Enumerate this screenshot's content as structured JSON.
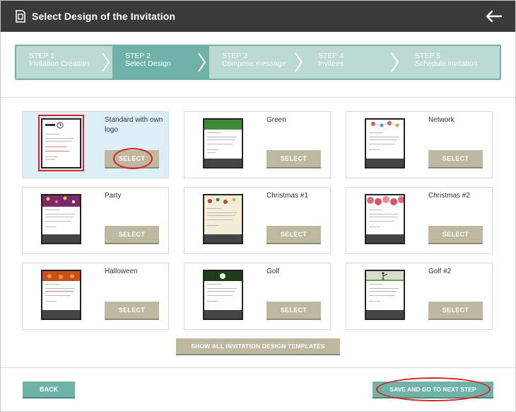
{
  "header": {
    "title": "Select Design of the Invitation",
    "icon": "invitation-doc-icon",
    "back_icon": "arrow-left-icon"
  },
  "stepper": {
    "steps": [
      {
        "num": "STEP 1",
        "label": "Invitation Creation",
        "state": "done"
      },
      {
        "num": "STEP 2",
        "label": "Select Design",
        "state": "active"
      },
      {
        "num": "STEP 3",
        "label": "Compose message",
        "state": "pending"
      },
      {
        "num": "STEP 4",
        "label": "Invitees",
        "state": "pending"
      },
      {
        "num": "STEP 5",
        "label": "Schedule invitation",
        "state": "pending"
      }
    ]
  },
  "designs": [
    {
      "name": "Standard with own logo",
      "button": "SELECT",
      "selected": true,
      "band_color": "#ffffff"
    },
    {
      "name": "Green",
      "button": "SELECT",
      "selected": false,
      "band_color": "#3f8a3a"
    },
    {
      "name": "Network",
      "button": "SELECT",
      "selected": false,
      "band_color": "#ffffff"
    },
    {
      "name": "Party",
      "button": "SELECT",
      "selected": false,
      "band_color": "#7a2a6a"
    },
    {
      "name": "Christmas #1",
      "button": "SELECT",
      "selected": false,
      "band_color": "#e6d9b5"
    },
    {
      "name": "Christmas #2",
      "button": "SELECT",
      "selected": false,
      "band_color": "#d9555f"
    },
    {
      "name": "Halloween",
      "button": "SELECT",
      "selected": false,
      "band_color": "#c7501c"
    },
    {
      "name": "Golf",
      "button": "SELECT",
      "selected": false,
      "band_color": "#1f3d1a"
    },
    {
      "name": "Golf #2",
      "button": "SELECT",
      "selected": false,
      "band_color": "#d8dcc9"
    }
  ],
  "actions": {
    "show_all": "SHOW ALL INVITATION DESIGN TEMPLATES",
    "back": "BACK",
    "next": "SAVE AND GO TO NEXT STEP"
  },
  "colors": {
    "header_bg": "#3a3a3a",
    "accent": "#6fb3a8",
    "select_btn": "#bdb89f",
    "highlight": "#dd2222"
  }
}
